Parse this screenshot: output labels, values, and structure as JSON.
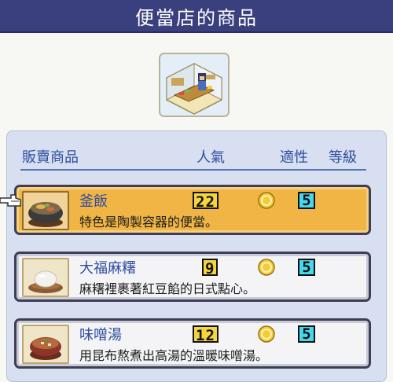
{
  "header": {
    "title": "便當店的商品"
  },
  "columns": {
    "item": "販賣商品",
    "popularity": "人氣",
    "suitability": "適性",
    "grade": "等級"
  },
  "items": [
    {
      "name": "釜飯",
      "desc": "特色是陶製容器的便當。",
      "popularity": "22",
      "suitability": "circle",
      "grade": "5",
      "selected": true,
      "icon": "kamameshi-icon"
    },
    {
      "name": "大福麻糬",
      "desc": "麻糬裡裹著紅豆餡的日式點心。",
      "popularity": "9",
      "suitability": "circle",
      "grade": "5",
      "selected": false,
      "icon": "daifuku-icon"
    },
    {
      "name": "味噌湯",
      "desc": "用昆布熬煮出高湯的溫暖味噌湯。",
      "popularity": "12",
      "suitability": "circle",
      "grade": "5",
      "selected": false,
      "icon": "miso-soup-icon"
    }
  ],
  "colors": {
    "title_bar": "#3a3f7e",
    "accent_text": "#2e4da0",
    "selected_card": "#f0b545",
    "grade_badge": "#45d8ef",
    "popularity_badge": "#f5d53c"
  }
}
